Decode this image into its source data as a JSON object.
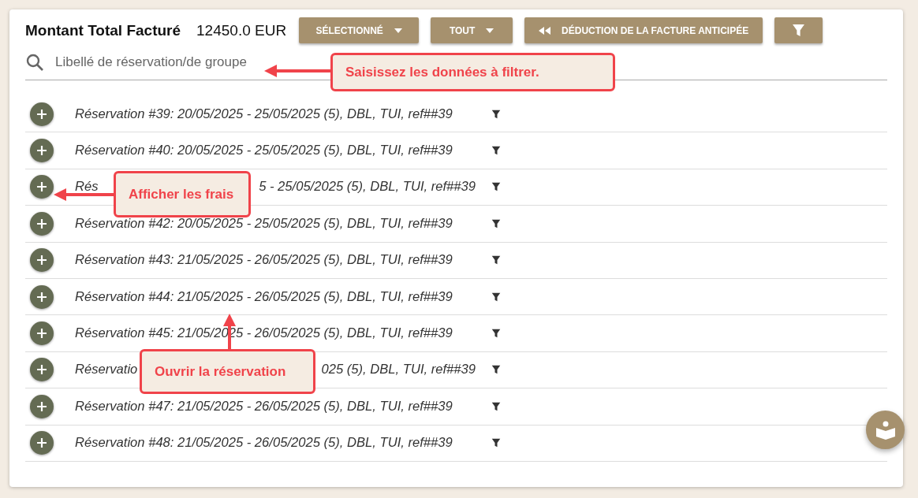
{
  "header": {
    "title": "Montant Total Facturé",
    "total": "12450.0 EUR"
  },
  "buttons": [
    {
      "kind": "dropdown",
      "label": "SÉLECTIONNÉ"
    },
    {
      "kind": "dropdown",
      "label": "TOUT"
    },
    {
      "kind": "back",
      "label": "DÉDUCTION DE LA FACTURE ANTICIPÉE"
    },
    {
      "kind": "filter"
    }
  ],
  "search": {
    "placeholder": "Libellé de réservation/de groupe"
  },
  "rows": [
    {
      "parts": [
        "Réservation #39: 20/05/2025 - 25/05/2025 (5), DBL, TUI, ref##39"
      ]
    },
    {
      "parts": [
        "Réservation #40: 20/05/2025 - 25/05/2025 (5), DBL, TUI, ref##39"
      ]
    },
    {
      "parts": [
        "Rés",
        "5 - 25/05/2025 (5), DBL, TUI, ref##39"
      ]
    },
    {
      "parts": [
        "Réservation #42: 20/05/2025 - 25/05/2025 (5), DBL, TUI, ref##39"
      ]
    },
    {
      "parts": [
        "Réservation #43: 21/05/2025 - 26/05/2025 (5), DBL, TUI, ref##39"
      ]
    },
    {
      "parts": [
        "Réservation #44: 21/05/2025 - 26/05/2025 (5), DBL, TUI, ref##39"
      ]
    },
    {
      "parts": [
        "Réservation #45: 21/05/2025 - 26/05/2025 (5), DBL, TUI, ref##39"
      ]
    },
    {
      "parts": [
        "Réservatio",
        "025 (5), DBL, TUI, ref##39"
      ]
    },
    {
      "parts": [
        "Réservation #47: 21/05/2025 - 26/05/2025 (5), DBL, TUI, ref##39"
      ]
    },
    {
      "parts": [
        "Réservation #48: 21/05/2025 - 26/05/2025 (5), DBL, TUI, ref##39"
      ]
    }
  ],
  "callouts": [
    {
      "text": "Saisissez les données à filtrer.",
      "kind": "left"
    },
    {
      "text": "Afficher les frais",
      "kind": "left"
    },
    {
      "text": "Ouvrir la réservation",
      "kind": "up"
    }
  ]
}
